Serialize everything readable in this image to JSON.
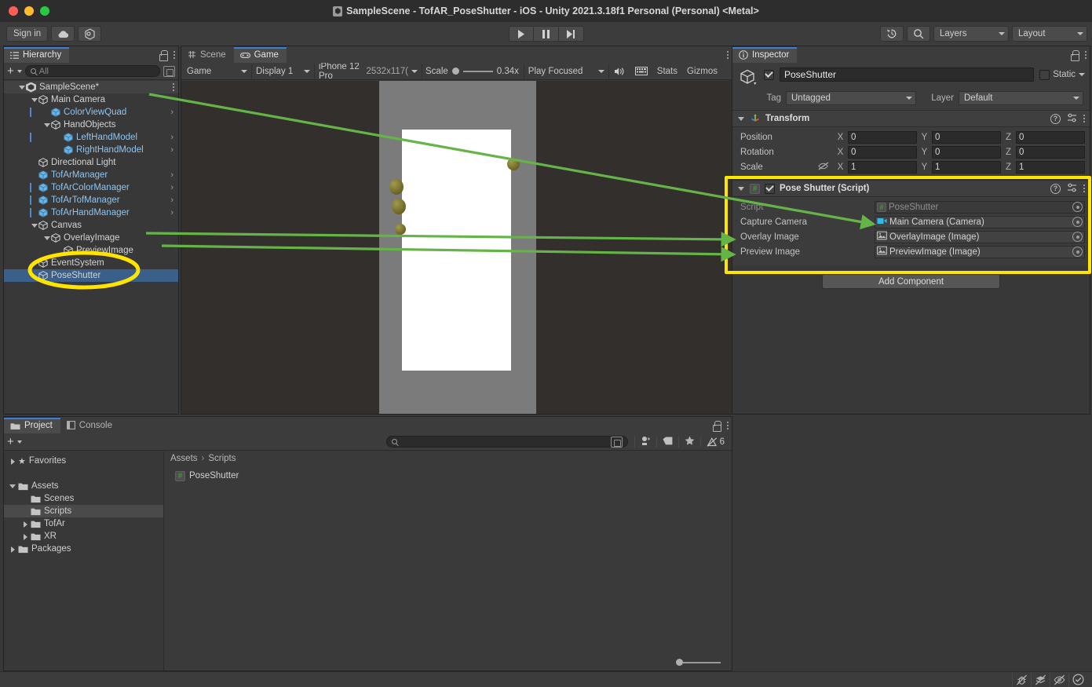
{
  "window": {
    "title": "SampleScene - TofAR_PoseShutter - iOS - Unity 2021.3.18f1 Personal (Personal) <Metal>"
  },
  "toolbar": {
    "sign_in": "Sign in",
    "cloud_icon": "cloud-icon",
    "services_icon": "unity-services-icon",
    "play_icon": "play-icon",
    "pause_icon": "pause-icon",
    "step_icon": "step-icon",
    "undo_history_icon": "undo-history-icon",
    "search_icon": "search-icon",
    "layers_label": "Layers",
    "layout_label": "Layout"
  },
  "hierarchy": {
    "tab_label": "Hierarchy",
    "add_label": "+",
    "search_placeholder": "All",
    "scene_name": "SampleScene*",
    "items": [
      {
        "label": "Main Camera",
        "depth": 1,
        "arrow": "open",
        "prefab": false,
        "chevron": false,
        "marker": false
      },
      {
        "label": "ColorViewQuad",
        "depth": 2,
        "arrow": "none",
        "prefab": true,
        "chevron": true,
        "marker": true
      },
      {
        "label": "HandObjects",
        "depth": 2,
        "arrow": "open",
        "prefab": false,
        "chevron": false,
        "marker": false
      },
      {
        "label": "LeftHandModel",
        "depth": 3,
        "arrow": "none",
        "prefab": true,
        "chevron": true,
        "marker": true
      },
      {
        "label": "RightHandModel",
        "depth": 3,
        "arrow": "none",
        "prefab": true,
        "chevron": true,
        "marker": false
      },
      {
        "label": "Directional Light",
        "depth": 1,
        "arrow": "none",
        "prefab": false,
        "chevron": false,
        "marker": false
      },
      {
        "label": "TofArManager",
        "depth": 1,
        "arrow": "none",
        "prefab": true,
        "chevron": true,
        "marker": false
      },
      {
        "label": "TofArColorManager",
        "depth": 1,
        "arrow": "none",
        "prefab": true,
        "chevron": true,
        "marker": true
      },
      {
        "label": "TofArTofManager",
        "depth": 1,
        "arrow": "none",
        "prefab": true,
        "chevron": true,
        "marker": true
      },
      {
        "label": "TofArHandManager",
        "depth": 1,
        "arrow": "none",
        "prefab": true,
        "chevron": true,
        "marker": true
      },
      {
        "label": "Canvas",
        "depth": 1,
        "arrow": "open",
        "prefab": false,
        "chevron": false,
        "marker": false
      },
      {
        "label": "OverlayImage",
        "depth": 2,
        "arrow": "open",
        "prefab": false,
        "chevron": false,
        "marker": false
      },
      {
        "label": "PreviewImage",
        "depth": 3,
        "arrow": "none",
        "prefab": false,
        "chevron": false,
        "marker": false
      },
      {
        "label": "EventSystem",
        "depth": 1,
        "arrow": "none",
        "prefab": false,
        "chevron": false,
        "marker": false
      },
      {
        "label": "PoseShutter",
        "depth": 1,
        "arrow": "none",
        "prefab": false,
        "chevron": false,
        "marker": false,
        "selected": true
      }
    ]
  },
  "gameview": {
    "tabs": [
      {
        "label": "Scene",
        "icon": "scene-icon",
        "active": false
      },
      {
        "label": "Game",
        "icon": "game-icon",
        "active": true
      }
    ],
    "mode": "Game",
    "display": "Display 1",
    "device": "iPhone 12 Pro",
    "resolution": "2532x117(",
    "scale_label": "Scale",
    "scale_value": "0.34x",
    "play_mode": "Play Focused",
    "mute_icon": "mute-audio-icon",
    "stats_label": "Stats",
    "gizmos_label": "Gizmos"
  },
  "inspector": {
    "tab_label": "Inspector",
    "object_name": "PoseShutter",
    "enabled": true,
    "static_label": "Static",
    "tag_label": "Tag",
    "tag_value": "Untagged",
    "layer_label": "Layer",
    "layer_value": "Default",
    "transform": {
      "title": "Transform",
      "rows": [
        {
          "name": "Position",
          "x": "0",
          "y": "0",
          "z": "0"
        },
        {
          "name": "Rotation",
          "x": "0",
          "y": "0",
          "z": "0"
        },
        {
          "name": "Scale",
          "x": "1",
          "y": "1",
          "z": "1"
        }
      ],
      "axis_labels": [
        "X",
        "Y",
        "Z"
      ]
    },
    "script_component": {
      "title": "Pose Shutter (Script)",
      "enabled": true,
      "fields": [
        {
          "name": "Script",
          "value": "PoseShutter",
          "icon": "cs-script-icon",
          "dim": true
        },
        {
          "name": "Capture Camera",
          "value": "Main Camera (Camera)",
          "icon": "camera-icon",
          "dim": false
        },
        {
          "name": "Overlay Image",
          "value": "OverlayImage (Image)",
          "icon": "image-icon",
          "dim": false
        },
        {
          "name": "Preview Image",
          "value": "PreviewImage (Image)",
          "icon": "image-icon",
          "dim": false
        }
      ]
    },
    "add_component_label": "Add Component"
  },
  "project": {
    "tabs": [
      {
        "label": "Project",
        "icon": "folder-icon",
        "active": true
      },
      {
        "label": "Console",
        "icon": "console-icon",
        "active": false
      }
    ],
    "search_placeholder": "",
    "warning_count": "6",
    "tree": [
      {
        "label": "Favorites",
        "depth": 0,
        "arrow": "closed",
        "icon": "star-icon",
        "selected": false
      },
      {
        "label": "",
        "depth": 0,
        "arrow": "none",
        "icon": "spacer",
        "selected": false
      },
      {
        "label": "Assets",
        "depth": 0,
        "arrow": "open",
        "icon": "folder-icon",
        "selected": false
      },
      {
        "label": "Scenes",
        "depth": 1,
        "arrow": "none",
        "icon": "folder-icon",
        "selected": false
      },
      {
        "label": "Scripts",
        "depth": 1,
        "arrow": "none",
        "icon": "folder-icon",
        "selected": true
      },
      {
        "label": "TofAr",
        "depth": 1,
        "arrow": "closed",
        "icon": "folder-icon",
        "selected": false
      },
      {
        "label": "XR",
        "depth": 1,
        "arrow": "closed",
        "icon": "folder-icon",
        "selected": false
      },
      {
        "label": "Packages",
        "depth": 0,
        "arrow": "closed",
        "icon": "folder-icon",
        "selected": false
      }
    ],
    "breadcrumb": [
      "Assets",
      "Scripts"
    ],
    "assets": [
      {
        "label": "PoseShutter",
        "icon": "cs-script-icon"
      }
    ]
  },
  "statusbar": {
    "icons": [
      "bug-off-icon",
      "layers-off-icon",
      "eye-off-icon",
      "check-circle-icon"
    ]
  },
  "annotation": {
    "highlight_color": "#ffe400",
    "arrow_color": "#65b447"
  }
}
